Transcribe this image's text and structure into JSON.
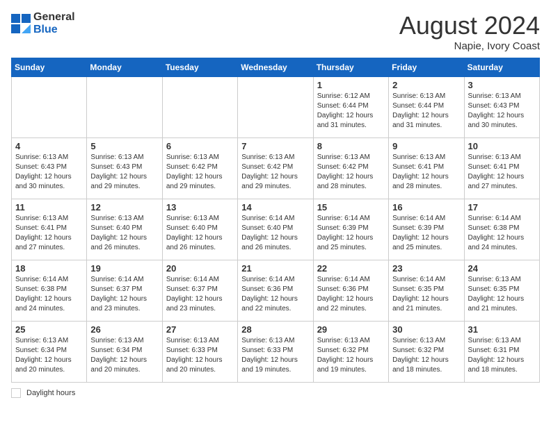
{
  "header": {
    "logo_line1": "General",
    "logo_line2": "Blue",
    "month_year": "August 2024",
    "location": "Napie, Ivory Coast"
  },
  "weekdays": [
    "Sunday",
    "Monday",
    "Tuesday",
    "Wednesday",
    "Thursday",
    "Friday",
    "Saturday"
  ],
  "footer": {
    "daylight_label": "Daylight hours"
  },
  "weeks": [
    [
      {
        "day": "",
        "info": ""
      },
      {
        "day": "",
        "info": ""
      },
      {
        "day": "",
        "info": ""
      },
      {
        "day": "",
        "info": ""
      },
      {
        "day": "1",
        "info": "Sunrise: 6:12 AM\nSunset: 6:44 PM\nDaylight: 12 hours\nand 31 minutes."
      },
      {
        "day": "2",
        "info": "Sunrise: 6:13 AM\nSunset: 6:44 PM\nDaylight: 12 hours\nand 31 minutes."
      },
      {
        "day": "3",
        "info": "Sunrise: 6:13 AM\nSunset: 6:43 PM\nDaylight: 12 hours\nand 30 minutes."
      }
    ],
    [
      {
        "day": "4",
        "info": "Sunrise: 6:13 AM\nSunset: 6:43 PM\nDaylight: 12 hours\nand 30 minutes."
      },
      {
        "day": "5",
        "info": "Sunrise: 6:13 AM\nSunset: 6:43 PM\nDaylight: 12 hours\nand 29 minutes."
      },
      {
        "day": "6",
        "info": "Sunrise: 6:13 AM\nSunset: 6:42 PM\nDaylight: 12 hours\nand 29 minutes."
      },
      {
        "day": "7",
        "info": "Sunrise: 6:13 AM\nSunset: 6:42 PM\nDaylight: 12 hours\nand 29 minutes."
      },
      {
        "day": "8",
        "info": "Sunrise: 6:13 AM\nSunset: 6:42 PM\nDaylight: 12 hours\nand 28 minutes."
      },
      {
        "day": "9",
        "info": "Sunrise: 6:13 AM\nSunset: 6:41 PM\nDaylight: 12 hours\nand 28 minutes."
      },
      {
        "day": "10",
        "info": "Sunrise: 6:13 AM\nSunset: 6:41 PM\nDaylight: 12 hours\nand 27 minutes."
      }
    ],
    [
      {
        "day": "11",
        "info": "Sunrise: 6:13 AM\nSunset: 6:41 PM\nDaylight: 12 hours\nand 27 minutes."
      },
      {
        "day": "12",
        "info": "Sunrise: 6:13 AM\nSunset: 6:40 PM\nDaylight: 12 hours\nand 26 minutes."
      },
      {
        "day": "13",
        "info": "Sunrise: 6:13 AM\nSunset: 6:40 PM\nDaylight: 12 hours\nand 26 minutes."
      },
      {
        "day": "14",
        "info": "Sunrise: 6:14 AM\nSunset: 6:40 PM\nDaylight: 12 hours\nand 26 minutes."
      },
      {
        "day": "15",
        "info": "Sunrise: 6:14 AM\nSunset: 6:39 PM\nDaylight: 12 hours\nand 25 minutes."
      },
      {
        "day": "16",
        "info": "Sunrise: 6:14 AM\nSunset: 6:39 PM\nDaylight: 12 hours\nand 25 minutes."
      },
      {
        "day": "17",
        "info": "Sunrise: 6:14 AM\nSunset: 6:38 PM\nDaylight: 12 hours\nand 24 minutes."
      }
    ],
    [
      {
        "day": "18",
        "info": "Sunrise: 6:14 AM\nSunset: 6:38 PM\nDaylight: 12 hours\nand 24 minutes."
      },
      {
        "day": "19",
        "info": "Sunrise: 6:14 AM\nSunset: 6:37 PM\nDaylight: 12 hours\nand 23 minutes."
      },
      {
        "day": "20",
        "info": "Sunrise: 6:14 AM\nSunset: 6:37 PM\nDaylight: 12 hours\nand 23 minutes."
      },
      {
        "day": "21",
        "info": "Sunrise: 6:14 AM\nSunset: 6:36 PM\nDaylight: 12 hours\nand 22 minutes."
      },
      {
        "day": "22",
        "info": "Sunrise: 6:14 AM\nSunset: 6:36 PM\nDaylight: 12 hours\nand 22 minutes."
      },
      {
        "day": "23",
        "info": "Sunrise: 6:14 AM\nSunset: 6:35 PM\nDaylight: 12 hours\nand 21 minutes."
      },
      {
        "day": "24",
        "info": "Sunrise: 6:13 AM\nSunset: 6:35 PM\nDaylight: 12 hours\nand 21 minutes."
      }
    ],
    [
      {
        "day": "25",
        "info": "Sunrise: 6:13 AM\nSunset: 6:34 PM\nDaylight: 12 hours\nand 20 minutes."
      },
      {
        "day": "26",
        "info": "Sunrise: 6:13 AM\nSunset: 6:34 PM\nDaylight: 12 hours\nand 20 minutes."
      },
      {
        "day": "27",
        "info": "Sunrise: 6:13 AM\nSunset: 6:33 PM\nDaylight: 12 hours\nand 20 minutes."
      },
      {
        "day": "28",
        "info": "Sunrise: 6:13 AM\nSunset: 6:33 PM\nDaylight: 12 hours\nand 19 minutes."
      },
      {
        "day": "29",
        "info": "Sunrise: 6:13 AM\nSunset: 6:32 PM\nDaylight: 12 hours\nand 19 minutes."
      },
      {
        "day": "30",
        "info": "Sunrise: 6:13 AM\nSunset: 6:32 PM\nDaylight: 12 hours\nand 18 minutes."
      },
      {
        "day": "31",
        "info": "Sunrise: 6:13 AM\nSunset: 6:31 PM\nDaylight: 12 hours\nand 18 minutes."
      }
    ]
  ]
}
